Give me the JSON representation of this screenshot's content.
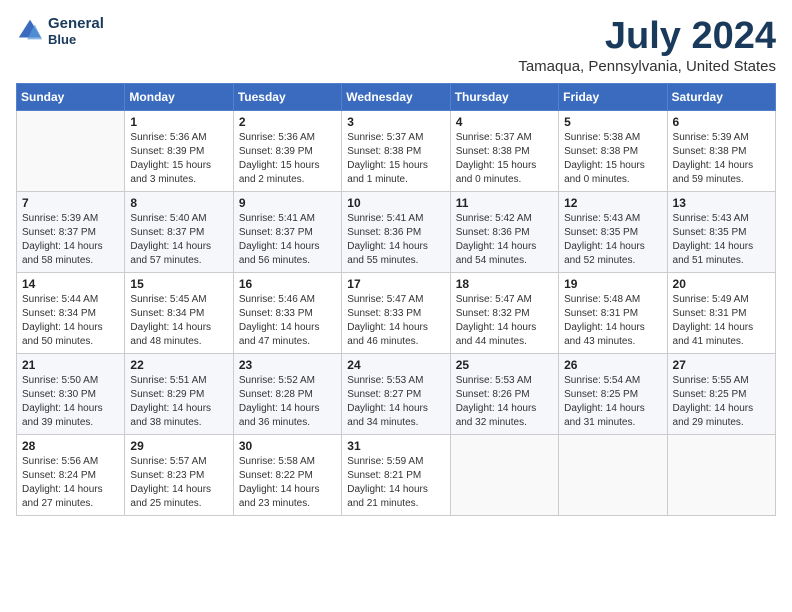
{
  "header": {
    "logo_line1": "General",
    "logo_line2": "Blue",
    "month_title": "July 2024",
    "location": "Tamaqua, Pennsylvania, United States"
  },
  "calendar": {
    "days_of_week": [
      "Sunday",
      "Monday",
      "Tuesday",
      "Wednesday",
      "Thursday",
      "Friday",
      "Saturday"
    ],
    "weeks": [
      [
        {
          "day": "",
          "info": ""
        },
        {
          "day": "1",
          "info": "Sunrise: 5:36 AM\nSunset: 8:39 PM\nDaylight: 15 hours\nand 3 minutes."
        },
        {
          "day": "2",
          "info": "Sunrise: 5:36 AM\nSunset: 8:39 PM\nDaylight: 15 hours\nand 2 minutes."
        },
        {
          "day": "3",
          "info": "Sunrise: 5:37 AM\nSunset: 8:38 PM\nDaylight: 15 hours\nand 1 minute."
        },
        {
          "day": "4",
          "info": "Sunrise: 5:37 AM\nSunset: 8:38 PM\nDaylight: 15 hours\nand 0 minutes."
        },
        {
          "day": "5",
          "info": "Sunrise: 5:38 AM\nSunset: 8:38 PM\nDaylight: 15 hours\nand 0 minutes."
        },
        {
          "day": "6",
          "info": "Sunrise: 5:39 AM\nSunset: 8:38 PM\nDaylight: 14 hours\nand 59 minutes."
        }
      ],
      [
        {
          "day": "7",
          "info": "Sunrise: 5:39 AM\nSunset: 8:37 PM\nDaylight: 14 hours\nand 58 minutes."
        },
        {
          "day": "8",
          "info": "Sunrise: 5:40 AM\nSunset: 8:37 PM\nDaylight: 14 hours\nand 57 minutes."
        },
        {
          "day": "9",
          "info": "Sunrise: 5:41 AM\nSunset: 8:37 PM\nDaylight: 14 hours\nand 56 minutes."
        },
        {
          "day": "10",
          "info": "Sunrise: 5:41 AM\nSunset: 8:36 PM\nDaylight: 14 hours\nand 55 minutes."
        },
        {
          "day": "11",
          "info": "Sunrise: 5:42 AM\nSunset: 8:36 PM\nDaylight: 14 hours\nand 54 minutes."
        },
        {
          "day": "12",
          "info": "Sunrise: 5:43 AM\nSunset: 8:35 PM\nDaylight: 14 hours\nand 52 minutes."
        },
        {
          "day": "13",
          "info": "Sunrise: 5:43 AM\nSunset: 8:35 PM\nDaylight: 14 hours\nand 51 minutes."
        }
      ],
      [
        {
          "day": "14",
          "info": "Sunrise: 5:44 AM\nSunset: 8:34 PM\nDaylight: 14 hours\nand 50 minutes."
        },
        {
          "day": "15",
          "info": "Sunrise: 5:45 AM\nSunset: 8:34 PM\nDaylight: 14 hours\nand 48 minutes."
        },
        {
          "day": "16",
          "info": "Sunrise: 5:46 AM\nSunset: 8:33 PM\nDaylight: 14 hours\nand 47 minutes."
        },
        {
          "day": "17",
          "info": "Sunrise: 5:47 AM\nSunset: 8:33 PM\nDaylight: 14 hours\nand 46 minutes."
        },
        {
          "day": "18",
          "info": "Sunrise: 5:47 AM\nSunset: 8:32 PM\nDaylight: 14 hours\nand 44 minutes."
        },
        {
          "day": "19",
          "info": "Sunrise: 5:48 AM\nSunset: 8:31 PM\nDaylight: 14 hours\nand 43 minutes."
        },
        {
          "day": "20",
          "info": "Sunrise: 5:49 AM\nSunset: 8:31 PM\nDaylight: 14 hours\nand 41 minutes."
        }
      ],
      [
        {
          "day": "21",
          "info": "Sunrise: 5:50 AM\nSunset: 8:30 PM\nDaylight: 14 hours\nand 39 minutes."
        },
        {
          "day": "22",
          "info": "Sunrise: 5:51 AM\nSunset: 8:29 PM\nDaylight: 14 hours\nand 38 minutes."
        },
        {
          "day": "23",
          "info": "Sunrise: 5:52 AM\nSunset: 8:28 PM\nDaylight: 14 hours\nand 36 minutes."
        },
        {
          "day": "24",
          "info": "Sunrise: 5:53 AM\nSunset: 8:27 PM\nDaylight: 14 hours\nand 34 minutes."
        },
        {
          "day": "25",
          "info": "Sunrise: 5:53 AM\nSunset: 8:26 PM\nDaylight: 14 hours\nand 32 minutes."
        },
        {
          "day": "26",
          "info": "Sunrise: 5:54 AM\nSunset: 8:25 PM\nDaylight: 14 hours\nand 31 minutes."
        },
        {
          "day": "27",
          "info": "Sunrise: 5:55 AM\nSunset: 8:25 PM\nDaylight: 14 hours\nand 29 minutes."
        }
      ],
      [
        {
          "day": "28",
          "info": "Sunrise: 5:56 AM\nSunset: 8:24 PM\nDaylight: 14 hours\nand 27 minutes."
        },
        {
          "day": "29",
          "info": "Sunrise: 5:57 AM\nSunset: 8:23 PM\nDaylight: 14 hours\nand 25 minutes."
        },
        {
          "day": "30",
          "info": "Sunrise: 5:58 AM\nSunset: 8:22 PM\nDaylight: 14 hours\nand 23 minutes."
        },
        {
          "day": "31",
          "info": "Sunrise: 5:59 AM\nSunset: 8:21 PM\nDaylight: 14 hours\nand 21 minutes."
        },
        {
          "day": "",
          "info": ""
        },
        {
          "day": "",
          "info": ""
        },
        {
          "day": "",
          "info": ""
        }
      ]
    ]
  }
}
